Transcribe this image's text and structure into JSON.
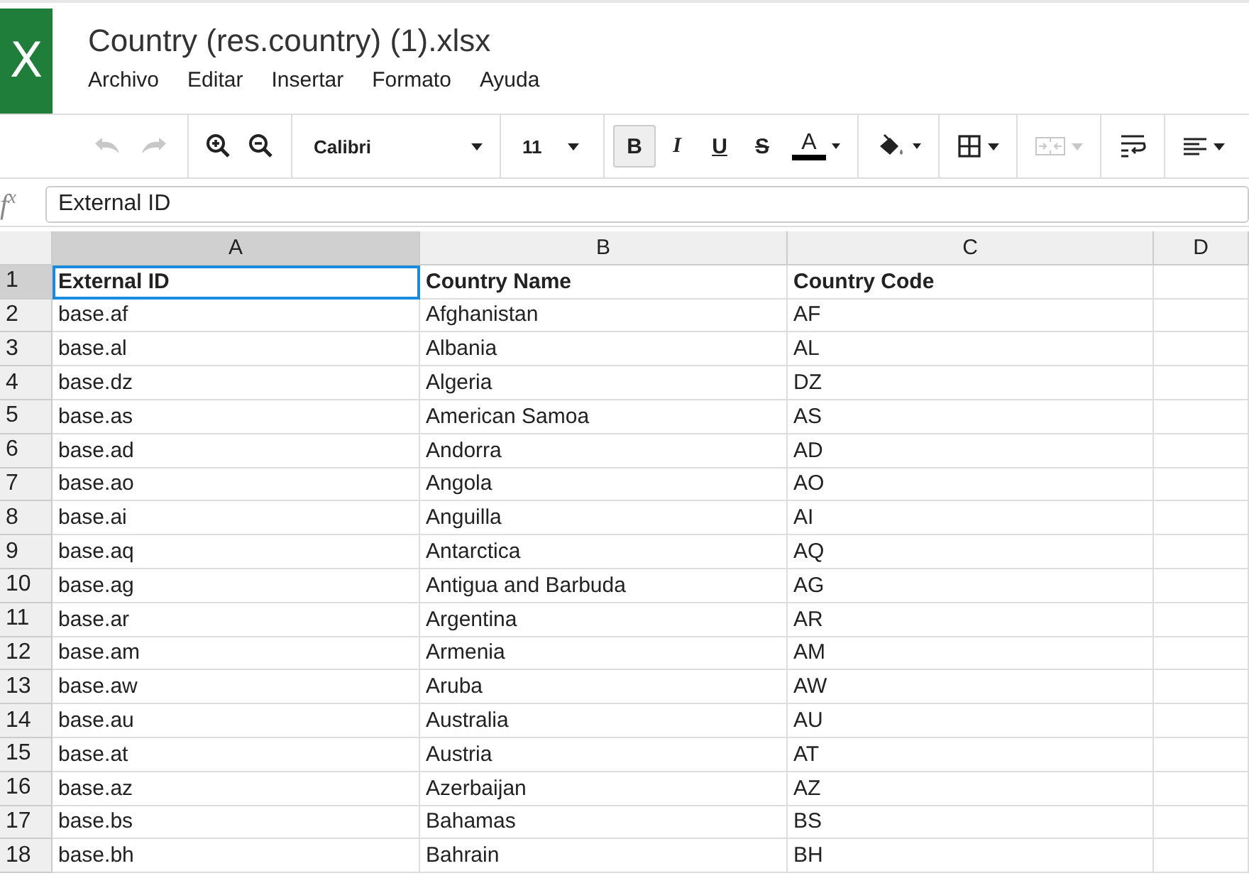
{
  "app": {
    "title": "Country (res.country) (1).xlsx",
    "logo": "X"
  },
  "menu": [
    "Archivo",
    "Editar",
    "Insertar",
    "Formato",
    "Ayuda"
  ],
  "toolbar_groups": [
    {
      "items": [
        {
          "kind": "undo",
          "disabled": true
        },
        {
          "kind": "redo",
          "disabled": true
        }
      ]
    },
    {
      "items": [
        {
          "kind": "zoom-in",
          "disabled": false
        },
        {
          "kind": "zoom-out",
          "disabled": false
        }
      ]
    },
    {
      "items": [
        {
          "kind": "font",
          "label": "Calibri",
          "disabled": false
        }
      ]
    },
    {
      "items": [
        {
          "kind": "size",
          "label": "11",
          "disabled": false
        }
      ]
    },
    {
      "items": [
        {
          "kind": "bold",
          "label": "B",
          "selected": true,
          "disabled": false
        },
        {
          "kind": "italic",
          "label": "I",
          "selected": false,
          "disabled": false
        },
        {
          "kind": "underline",
          "label": "U",
          "selected": false,
          "disabled": false
        },
        {
          "kind": "strike",
          "label": "S",
          "selected": false,
          "disabled": false
        },
        {
          "kind": "text-color",
          "label": "A",
          "color": "#000000",
          "disabled": false
        }
      ]
    },
    {
      "items": [
        {
          "kind": "fill",
          "disabled": false
        }
      ]
    },
    {
      "items": [
        {
          "kind": "borders",
          "disabled": false
        }
      ]
    },
    {
      "items": [
        {
          "kind": "merge",
          "disabled": true
        }
      ]
    },
    {
      "items": [
        {
          "kind": "wrap",
          "disabled": false
        }
      ]
    },
    {
      "items": [
        {
          "kind": "align",
          "disabled": false
        }
      ]
    }
  ],
  "formula_bar": {
    "icon": "f",
    "sup": "x",
    "value": "External ID"
  },
  "columns": [
    {
      "label": "A",
      "selected": true
    },
    {
      "label": "B",
      "selected": false
    },
    {
      "label": "C",
      "selected": false
    },
    {
      "label": "D",
      "selected": false
    }
  ],
  "rows": [
    {
      "number": "1",
      "selected": true,
      "bold": true,
      "cells": [
        {
          "text": "External ID",
          "selected": true
        },
        {
          "text": "Country Name",
          "selected": false
        },
        {
          "text": "Country Code",
          "selected": false
        }
      ]
    },
    {
      "number": "2",
      "selected": false,
      "bold": false,
      "cells": [
        {
          "text": "base.af",
          "selected": false
        },
        {
          "text": "Afghanistan",
          "selected": false
        },
        {
          "text": "AF",
          "selected": false
        }
      ]
    },
    {
      "number": "3",
      "selected": false,
      "bold": false,
      "cells": [
        {
          "text": "base.al",
          "selected": false
        },
        {
          "text": "Albania",
          "selected": false
        },
        {
          "text": "AL",
          "selected": false
        }
      ]
    },
    {
      "number": "4",
      "selected": false,
      "bold": false,
      "cells": [
        {
          "text": "base.dz",
          "selected": false
        },
        {
          "text": "Algeria",
          "selected": false
        },
        {
          "text": "DZ",
          "selected": false
        }
      ]
    },
    {
      "number": "5",
      "selected": false,
      "bold": false,
      "cells": [
        {
          "text": "base.as",
          "selected": false
        },
        {
          "text": "American Samoa",
          "selected": false
        },
        {
          "text": "AS",
          "selected": false
        }
      ]
    },
    {
      "number": "6",
      "selected": false,
      "bold": false,
      "cells": [
        {
          "text": "base.ad",
          "selected": false
        },
        {
          "text": "Andorra",
          "selected": false
        },
        {
          "text": "AD",
          "selected": false
        }
      ]
    },
    {
      "number": "7",
      "selected": false,
      "bold": false,
      "cells": [
        {
          "text": "base.ao",
          "selected": false
        },
        {
          "text": "Angola",
          "selected": false
        },
        {
          "text": "AO",
          "selected": false
        }
      ]
    },
    {
      "number": "8",
      "selected": false,
      "bold": false,
      "cells": [
        {
          "text": "base.ai",
          "selected": false
        },
        {
          "text": "Anguilla",
          "selected": false
        },
        {
          "text": "AI",
          "selected": false
        }
      ]
    },
    {
      "number": "9",
      "selected": false,
      "bold": false,
      "cells": [
        {
          "text": "base.aq",
          "selected": false
        },
        {
          "text": "Antarctica",
          "selected": false
        },
        {
          "text": "AQ",
          "selected": false
        }
      ]
    },
    {
      "number": "10",
      "selected": false,
      "bold": false,
      "cells": [
        {
          "text": "base.ag",
          "selected": false
        },
        {
          "text": "Antigua and Barbuda",
          "selected": false
        },
        {
          "text": "AG",
          "selected": false
        }
      ]
    },
    {
      "number": "11",
      "selected": false,
      "bold": false,
      "cells": [
        {
          "text": "base.ar",
          "selected": false
        },
        {
          "text": "Argentina",
          "selected": false
        },
        {
          "text": "AR",
          "selected": false
        }
      ]
    },
    {
      "number": "12",
      "selected": false,
      "bold": false,
      "cells": [
        {
          "text": "base.am",
          "selected": false
        },
        {
          "text": "Armenia",
          "selected": false
        },
        {
          "text": "AM",
          "selected": false
        }
      ]
    },
    {
      "number": "13",
      "selected": false,
      "bold": false,
      "cells": [
        {
          "text": "base.aw",
          "selected": false
        },
        {
          "text": "Aruba",
          "selected": false
        },
        {
          "text": "AW",
          "selected": false
        }
      ]
    },
    {
      "number": "14",
      "selected": false,
      "bold": false,
      "cells": [
        {
          "text": "base.au",
          "selected": false
        },
        {
          "text": "Australia",
          "selected": false
        },
        {
          "text": "AU",
          "selected": false
        }
      ]
    },
    {
      "number": "15",
      "selected": false,
      "bold": false,
      "cells": [
        {
          "text": "base.at",
          "selected": false
        },
        {
          "text": "Austria",
          "selected": false
        },
        {
          "text": "AT",
          "selected": false
        }
      ]
    },
    {
      "number": "16",
      "selected": false,
      "bold": false,
      "cells": [
        {
          "text": "base.az",
          "selected": false
        },
        {
          "text": "Azerbaijan",
          "selected": false
        },
        {
          "text": "AZ",
          "selected": false
        }
      ]
    },
    {
      "number": "17",
      "selected": false,
      "bold": false,
      "cells": [
        {
          "text": "base.bs",
          "selected": false
        },
        {
          "text": "Bahamas",
          "selected": false
        },
        {
          "text": "BS",
          "selected": false
        }
      ]
    },
    {
      "number": "18",
      "selected": false,
      "bold": false,
      "cells": [
        {
          "text": "base.bh",
          "selected": false
        },
        {
          "text": "Bahrain",
          "selected": false
        },
        {
          "text": "BH",
          "selected": false
        }
      ]
    }
  ]
}
